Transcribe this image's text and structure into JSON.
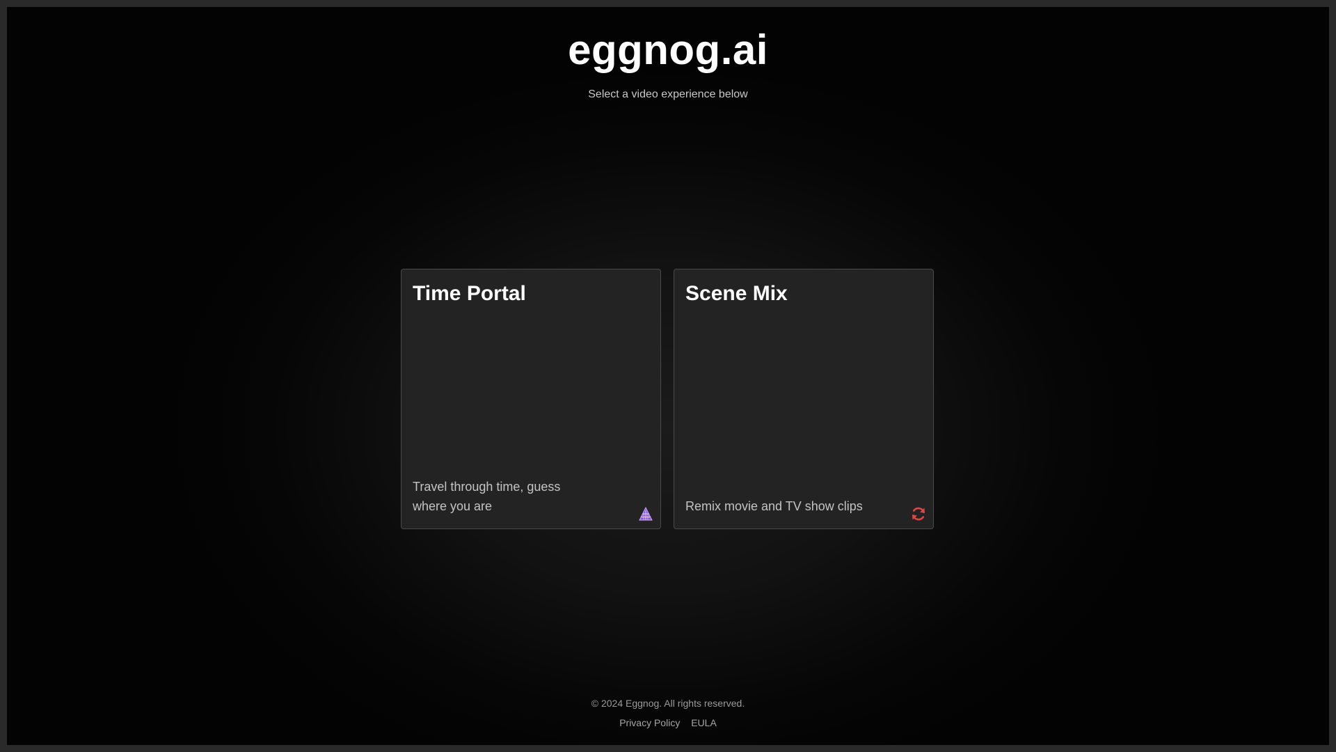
{
  "header": {
    "brand": "eggnog.ai",
    "subtitle": "Select a video experience below"
  },
  "cards": [
    {
      "title": "Time Portal",
      "description": "Travel through time, guess where you are",
      "icon": "pyramid-icon",
      "icon_color": "#8a5cd6"
    },
    {
      "title": "Scene Mix",
      "description": "Remix movie and TV show clips",
      "icon": "refresh-icon",
      "icon_color": "#e04545"
    }
  ],
  "footer": {
    "copyright": "© 2024 Eggnog. All rights reserved.",
    "links": [
      "Privacy Policy",
      "EULA"
    ]
  }
}
